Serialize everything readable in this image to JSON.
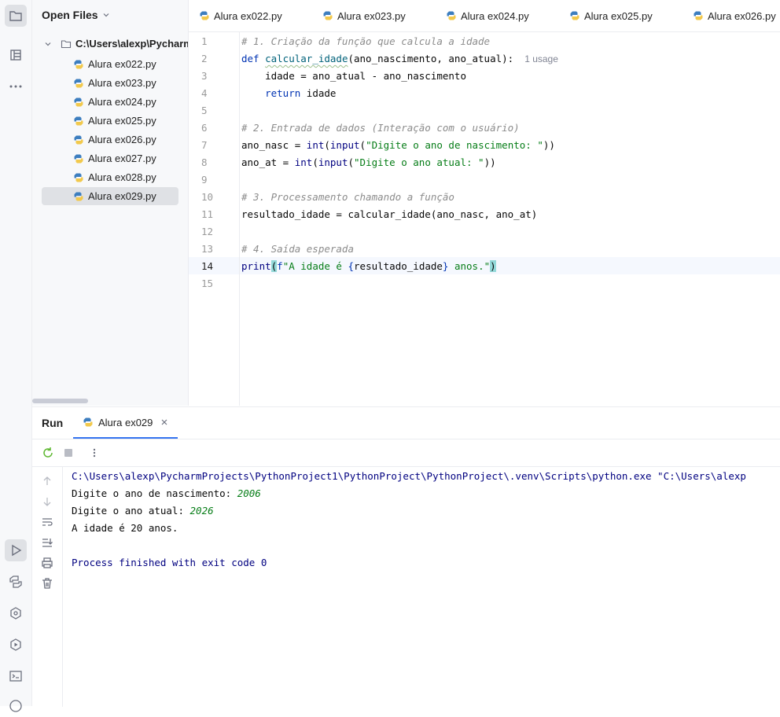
{
  "project_panel": {
    "title": "Open Files",
    "root": "C:\\Users\\alexp\\Pycharm",
    "files": [
      "Alura ex022.py",
      "Alura ex023.py",
      "Alura ex024.py",
      "Alura ex025.py",
      "Alura ex026.py",
      "Alura ex027.py",
      "Alura ex028.py",
      "Alura ex029.py"
    ],
    "selected": "Alura ex029.py"
  },
  "tabs": [
    "Alura ex022.py",
    "Alura ex023.py",
    "Alura ex024.py",
    "Alura ex025.py",
    "Alura ex026.py"
  ],
  "editor": {
    "line_numbers": [
      "1",
      "2",
      "3",
      "4",
      "5",
      "6",
      "7",
      "8",
      "9",
      "10",
      "11",
      "12",
      "13",
      "14",
      "15"
    ],
    "current_line": "14",
    "line1": "# 1. Criação da função que calcula a idade",
    "line2_def": "def",
    "line2_name": "calcular_idade",
    "line2_params": "(ano_nascimento, ano_atual):",
    "line2_usage": "1 usage",
    "line3": "    idade = ano_atual - ano_nascimento",
    "line4_kw": "return",
    "line4_rest": " idade",
    "line6": "# 2. Entrada de dados (Interação com o usuário)",
    "line7_a": "ano_nasc = ",
    "line7_int": "int",
    "line7_p1": "(",
    "line7_input": "input",
    "line7_p2": "(",
    "line7_str": "\"Digite o ano de nascimento: \"",
    "line7_end": "))",
    "line8_a": "ano_at = ",
    "line8_int": "int",
    "line8_p1": "(",
    "line8_input": "input",
    "line8_p2": "(",
    "line8_str": "\"Digite o ano atual: \"",
    "line8_end": "))",
    "line10": "# 3. Processamento chamando a função",
    "line11": "resultado_idade = calcular_idade(ano_nasc, ano_at)",
    "line13": "# 4. Saída esperada",
    "line14_print": "print",
    "line14_p1": "(",
    "line14_f": "f",
    "line14_s1": "\"A idade é ",
    "line14_b1": "{",
    "line14_var": "resultado_idade",
    "line14_b2": "}",
    "line14_s2": " anos.\"",
    "line14_p2": ")"
  },
  "run": {
    "title": "Run",
    "tab": "Alura ex029",
    "cmd": "C:\\Users\\alexp\\PycharmProjects\\PythonProject1\\PythonProject\\PythonProject\\.venv\\Scripts\\python.exe \"C:\\Users\\alexp",
    "prompt1": "Digite o ano de nascimento: ",
    "input1": "2006",
    "prompt2": "Digite o ano atual: ",
    "input2": "2026",
    "result": "A idade é 20 anos.",
    "finished": "Process finished with exit code 0"
  }
}
